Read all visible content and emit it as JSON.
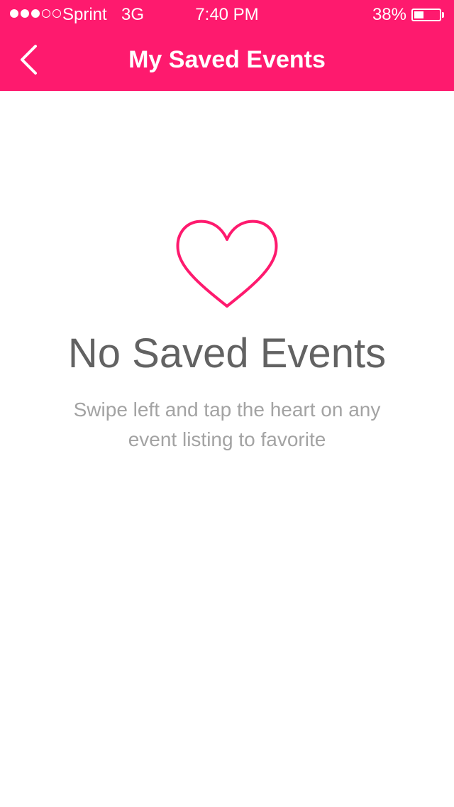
{
  "status_bar": {
    "carrier": "Sprint",
    "network": "3G",
    "time": "7:40 PM",
    "battery_percent": "38%",
    "battery_level": 0.38,
    "signal_bars_filled": 3,
    "signal_bars_total": 5
  },
  "nav": {
    "back_icon": "chevron-left-icon",
    "title": "My Saved Events"
  },
  "empty_state": {
    "icon": "heart-outline-icon",
    "title": "No Saved Events",
    "message": "Swipe left and tap the heart on any event listing to favorite"
  },
  "colors": {
    "accent": "#fe1a6e",
    "title_text": "#626262",
    "body_text": "#a3a3a3",
    "background": "#ffffff"
  }
}
